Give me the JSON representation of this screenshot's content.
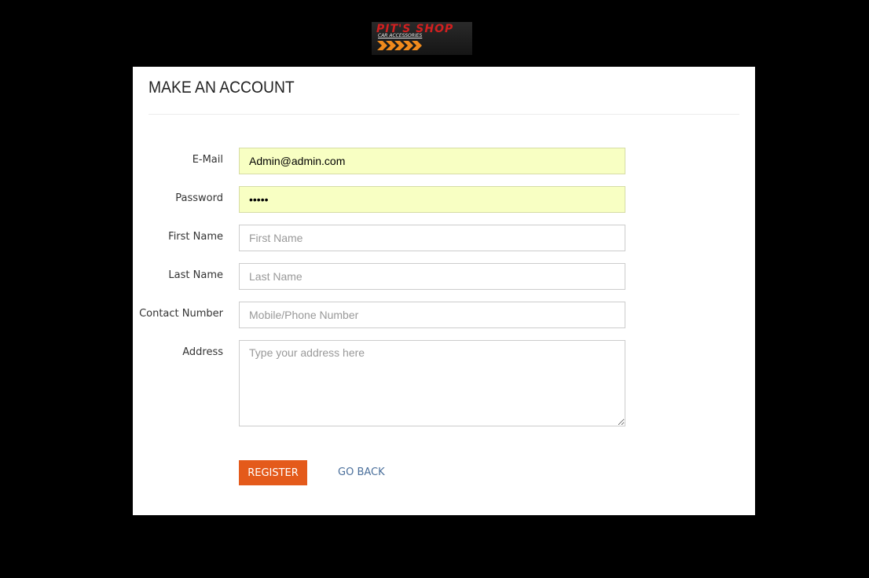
{
  "brand": {
    "logo_title": "PIT'S SHOP",
    "logo_subtitle": "CAR ACCESSORIES",
    "accent_color": "#e45a1b",
    "logo_red": "#d31f1f",
    "logo_arrows": "#f08a1c"
  },
  "form": {
    "title": "MAKE AN ACCOUNT",
    "fields": {
      "email": {
        "label": "E-Mail",
        "value": "Admin@admin.com",
        "placeholder": ""
      },
      "password": {
        "label": "Password",
        "value": "admin",
        "placeholder": ""
      },
      "first_name": {
        "label": "First Name",
        "value": "",
        "placeholder": "First Name"
      },
      "last_name": {
        "label": "Last Name",
        "value": "",
        "placeholder": "Last Name"
      },
      "contact": {
        "label": "Contact Number",
        "value": "",
        "placeholder": "Mobile/Phone Number"
      },
      "address": {
        "label": "Address",
        "value": "",
        "placeholder": "Type your address here"
      }
    },
    "actions": {
      "register_label": "REGISTER",
      "back_label": "GO BACK"
    }
  }
}
